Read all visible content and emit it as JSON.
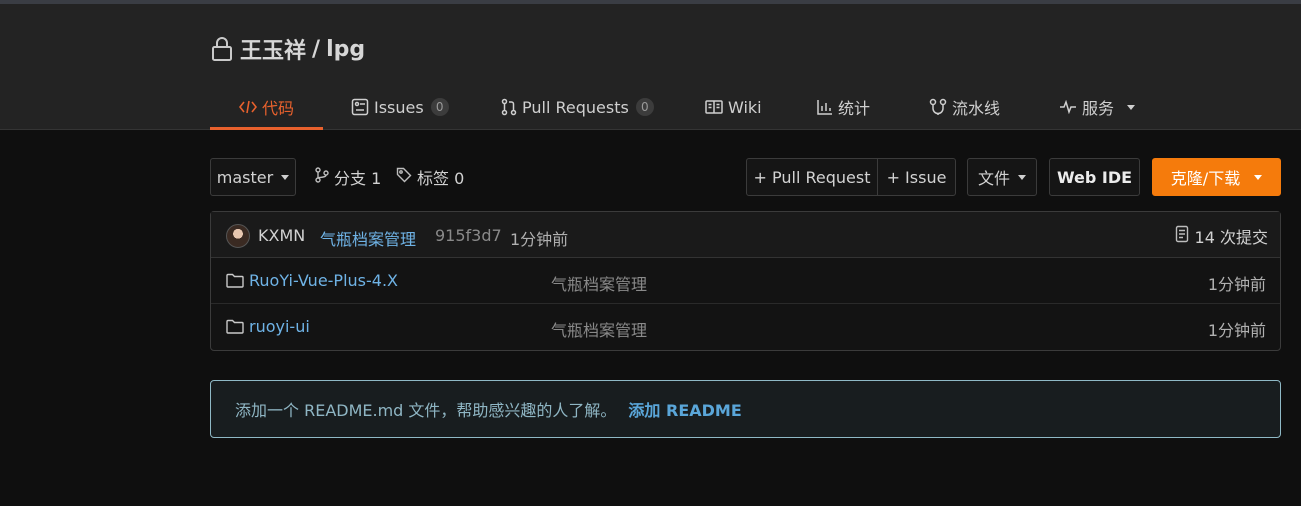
{
  "repo": {
    "owner": "王玉祥",
    "separator": "/",
    "name": "lpg"
  },
  "tabs": [
    {
      "label": "代码",
      "icon": "code-icon",
      "active": true
    },
    {
      "label": "Issues",
      "icon": "issues-icon",
      "count": "0"
    },
    {
      "label": "Pull Requests",
      "icon": "pull-request-icon",
      "count": "0"
    },
    {
      "label": "Wiki",
      "icon": "book-icon"
    },
    {
      "label": "统计",
      "icon": "bar-chart-icon"
    },
    {
      "label": "流水线",
      "icon": "pipeline-icon"
    },
    {
      "label": "服务",
      "icon": "pulse-icon"
    }
  ],
  "toolbar": {
    "branch_select": "master",
    "branches_label": "分支 1",
    "tags_label": "标签 0",
    "pull_request_btn": "+ Pull Request",
    "issue_btn": "+ Issue",
    "file_btn": "文件",
    "webide_btn": "Web IDE",
    "clone_btn": "克隆/下载"
  },
  "commit": {
    "author": "KXMN",
    "message": "气瓶档案管理",
    "sha": "915f3d7",
    "time": "1分钟前",
    "count_label": "14 次提交"
  },
  "files": [
    {
      "name": "RuoYi-Vue-Plus-4.X",
      "message": "气瓶档案管理",
      "time": "1分钟前"
    },
    {
      "name": "ruoyi-ui",
      "message": "气瓶档案管理",
      "time": "1分钟前"
    }
  ],
  "readme": {
    "text": "添加一个 README.md 文件，帮助感兴趣的人了解。",
    "link": "添加 README"
  },
  "colors": {
    "accent": "#e8612d",
    "clone": "#f57b0c",
    "link": "#6fb3e6"
  }
}
